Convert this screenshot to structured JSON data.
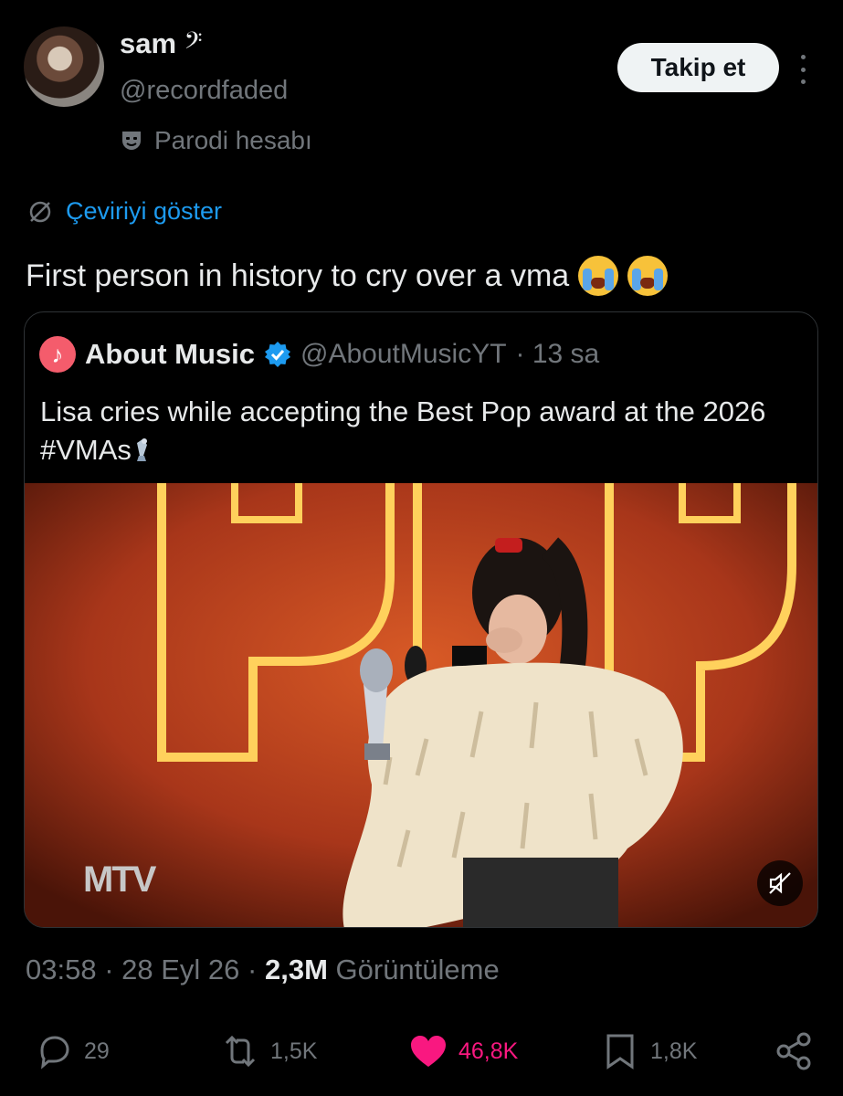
{
  "author": {
    "name": "sam",
    "name_suffix": "𝄢",
    "handle": "@recordfaded",
    "label": "Parodi hesabı",
    "label_icon": "theater-mask-icon",
    "follow_label": "Takip et"
  },
  "translate_label": "Çeviriyi göster",
  "tweet": {
    "text": "First person in history to cry over a vma",
    "emoji": "loudly-crying-face ×2"
  },
  "quoted": {
    "name": "About Music",
    "handle": "@AboutMusicYT",
    "time": "· 13 sa",
    "text": "Lisa cries while accepting the Best Pop award at the 2026 #VMAs",
    "media_logo": "MTV",
    "media_logo_display": "M‌TV"
  },
  "meta": {
    "time": "03:58",
    "date": "28 Eyl 26",
    "views": "2,3M",
    "views_label": "Görüntüleme"
  },
  "actions": {
    "replies": "29",
    "reposts": "1,5K",
    "likes": "46,8K",
    "bookmarks": "1,8K"
  },
  "colors": {
    "background": "#000000",
    "accent": "#1d9bf0",
    "like": "#f91880",
    "muted": "#71767b"
  }
}
